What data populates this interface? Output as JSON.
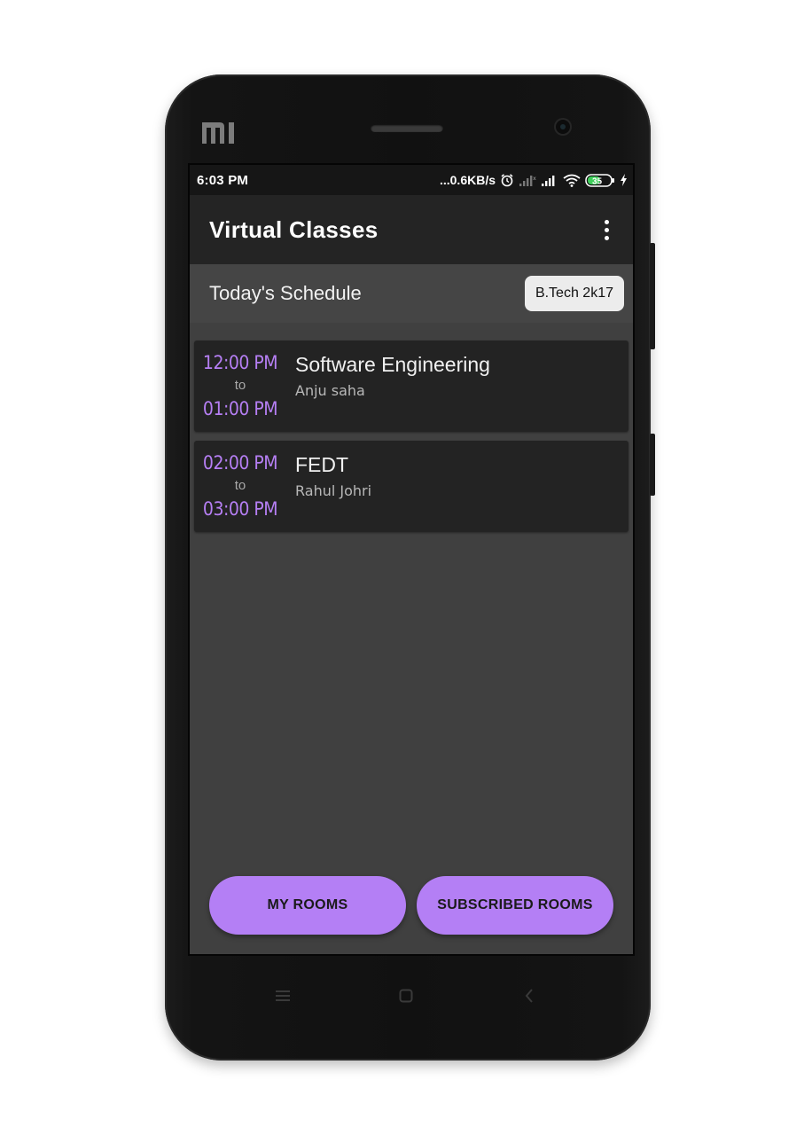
{
  "status_bar": {
    "time": "6:03 PM",
    "network_speed": "...0.6KB/s",
    "battery_level": "35",
    "icons": [
      "alarm-icon",
      "signal-weak-icon",
      "signal-icon",
      "wifi-icon",
      "battery-icon",
      "charging-icon"
    ]
  },
  "app_bar": {
    "title": "Virtual Classes",
    "menu_icon": "more-vertical-icon"
  },
  "schedule": {
    "heading": "Today's Schedule",
    "batch": "B.Tech 2k17",
    "classes": [
      {
        "start": "12:00 PM",
        "separator": "to",
        "end": "01:00 PM",
        "subject": "Software Engineering",
        "teacher": "Anju saha"
      },
      {
        "start": "02:00 PM",
        "separator": "to",
        "end": "03:00 PM",
        "subject": "FEDT",
        "teacher": "Rahul Johri"
      }
    ]
  },
  "actions": {
    "my_rooms": "MY ROOMS",
    "subscribed_rooms": "SUBSCRIBED ROOMS"
  },
  "colors": {
    "accent": "#b47ff5",
    "time_text": "#b67ff4",
    "background": "#404040",
    "card": "#232323",
    "app_bar": "#242424"
  },
  "device": {
    "nav_icons": [
      "menu-icon",
      "home-square-icon",
      "back-chevron-icon"
    ]
  }
}
